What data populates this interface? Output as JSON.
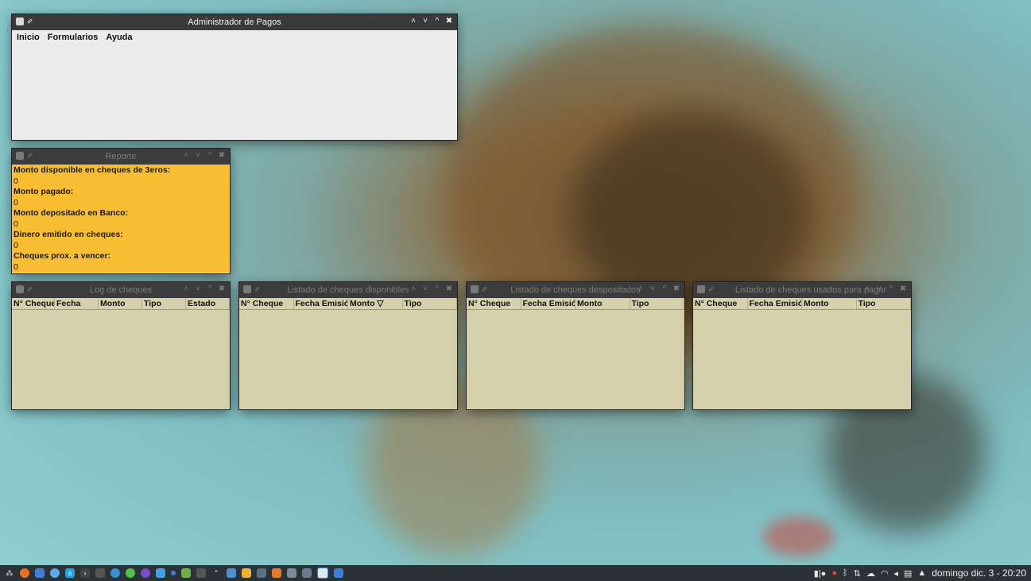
{
  "main_window": {
    "title": "Administrador de Pagos",
    "menu": [
      "Inicio",
      "Formularios",
      "Ayuda"
    ]
  },
  "report_window": {
    "title": "Reporte",
    "items": [
      {
        "label": "Monto disponible en cheques de 3eros:",
        "value": "0"
      },
      {
        "label": "Monto pagado:",
        "value": "0"
      },
      {
        "label": "Monto depositado en Banco:",
        "value": "0"
      },
      {
        "label": "Dinero emitido en cheques:",
        "value": "0"
      },
      {
        "label": "Cheques prox. a vencer:",
        "value": "0"
      }
    ]
  },
  "log_window": {
    "title": "Log de cheques",
    "columns": [
      "N° Cheque",
      "Fecha",
      "Monto",
      "Tipo",
      "Estado"
    ]
  },
  "disponibles_window": {
    "title": "Listado de cheques disponibles",
    "columns": [
      "N° Cheque",
      "Fecha Emisión",
      "Monto ▽",
      "Tipo"
    ]
  },
  "depositados_window": {
    "title": "Listado de cheques despositados",
    "columns": [
      "N° Cheque",
      "Fecha Emisión",
      "Monto",
      "Tipo"
    ]
  },
  "usados_window": {
    "title": "Listado de cheques usados para pagar",
    "columns": [
      "N° Cheque",
      "Fecha Emisión",
      "Monto",
      "Tipo"
    ]
  },
  "taskbar": {
    "clock": "domingo dic. 3 - 20:20",
    "launcher_icons": [
      "start-menu-icon",
      "firefox-icon",
      "files-icon",
      "chromium-icon",
      "skype-icon",
      "terminal-icon",
      "editor-icon",
      "browser-icon",
      "spotify-icon",
      "media-icon",
      "viewer-icon",
      "dot-icon",
      "game-icon",
      "text-icon",
      "settings-icon",
      "app-icon",
      "folder-icon",
      "window-icon",
      "calendar-icon",
      "image-viewer-icon",
      "mail-icon",
      "java-icon",
      "document-icon"
    ],
    "tray_icons": [
      "battery-icon",
      "gmail-icon",
      "bluetooth-icon",
      "usb-icon",
      "cloud-icon",
      "wifi-icon",
      "volume-icon",
      "clipboard-icon",
      "arrow-up-icon"
    ]
  },
  "colors": {
    "report_bg": "#f8bd32",
    "table_bg": "#d7d0ac",
    "titlebar": "#3a3a3a"
  }
}
